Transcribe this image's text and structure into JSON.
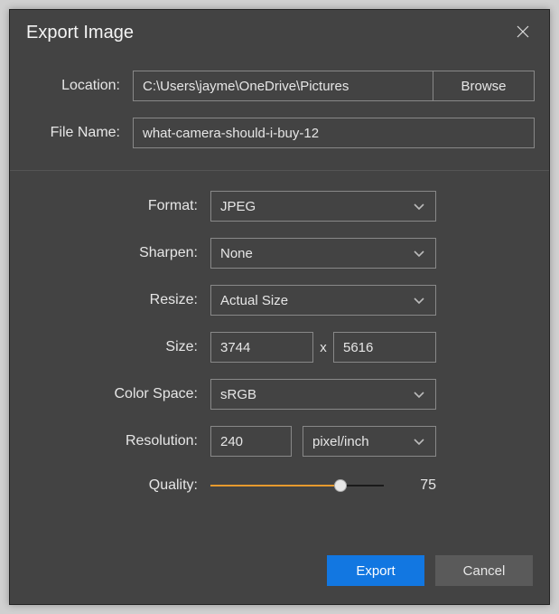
{
  "dialog": {
    "title": "Export Image"
  },
  "top": {
    "location_label": "Location:",
    "location_value": "C:\\Users\\jayme\\OneDrive\\Pictures",
    "browse_label": "Browse",
    "filename_label": "File Name:",
    "filename_value": "what-camera-should-i-buy-12"
  },
  "options": {
    "format_label": "Format:",
    "format_value": "JPEG",
    "sharpen_label": "Sharpen:",
    "sharpen_value": "None",
    "resize_label": "Resize:",
    "resize_value": "Actual Size",
    "size_label": "Size:",
    "size_width": "3744",
    "size_sep": "x",
    "size_height": "5616",
    "colorspace_label": "Color Space:",
    "colorspace_value": "sRGB",
    "resolution_label": "Resolution:",
    "resolution_value": "240",
    "resolution_unit": "pixel/inch",
    "quality_label": "Quality:",
    "quality_value": "75",
    "quality_percent": 75
  },
  "footer": {
    "export_label": "Export",
    "cancel_label": "Cancel"
  }
}
